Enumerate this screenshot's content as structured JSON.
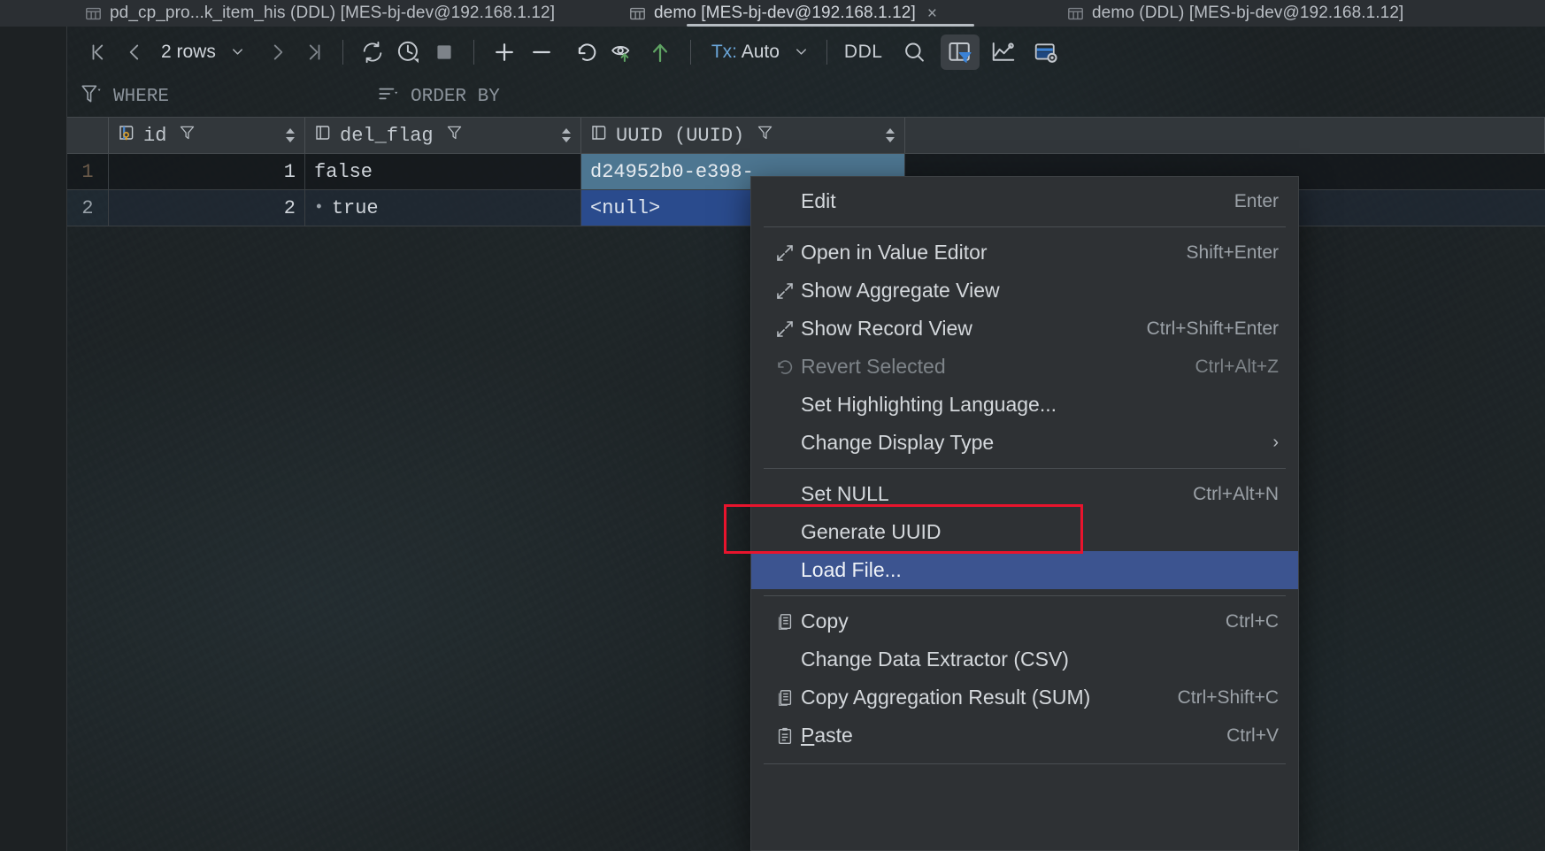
{
  "window": {
    "tabs": [
      {
        "label": "pd_cp_pro...k_item_his (DDL) [MES-bj-dev@192.168.1.12]",
        "icon": "table-icon",
        "active": false,
        "closable": false
      },
      {
        "label": "demo [MES-bj-dev@192.168.1.12]",
        "icon": "table-icon",
        "active": true,
        "closable": true,
        "close_label": "×"
      },
      {
        "label": "demo (DDL) [MES-bj-dev@192.168.1.12]",
        "icon": "table-icon",
        "active": false,
        "closable": false
      }
    ]
  },
  "toolbar": {
    "first_page": "first-page-icon",
    "prev_page": "prev-page-icon",
    "rows_label": "2 rows",
    "rows_chevron": "⌄",
    "next_page": "next-page-icon",
    "last_page": "last-page-icon",
    "reload": "reload-icon",
    "history": "history-icon",
    "stop": "stop-icon",
    "add_row": "plus-icon",
    "delete_row": "minus-icon",
    "revert": "revert-icon",
    "preview": "preview-changes-icon",
    "submit": "submit-icon",
    "tx_prefix": "Tx:",
    "tx_value": "Auto",
    "tx_chevron": "⌄",
    "ddl": "DDL",
    "search": "search-icon",
    "filter_panel": "toggle-filter-panel-icon",
    "chart": "chart-icon",
    "value_editor": "value-editor-icon"
  },
  "filterbar": {
    "where_icon": "filter-dropdown-icon",
    "where_label": "WHERE",
    "order_icon": "sort-dropdown-icon",
    "order_label": "ORDER BY"
  },
  "grid": {
    "columns": [
      {
        "key": "rownum",
        "label": "",
        "icon": "",
        "filter_icon": "",
        "sortable": false
      },
      {
        "key": "id",
        "label": "id",
        "icon": "primary-key-column-icon",
        "filter_icon": "column-filter-icon",
        "sortable": true
      },
      {
        "key": "del_flag",
        "label": "del_flag",
        "icon": "column-icon",
        "filter_icon": "column-filter-icon",
        "sortable": true
      },
      {
        "key": "uuid",
        "label": "UUID (UUID)",
        "icon": "column-icon",
        "filter_icon": "column-filter-icon",
        "sortable": true
      }
    ],
    "rows": [
      {
        "rownum": "1",
        "id": "1",
        "del_flag": "false",
        "del_flag_modified": false,
        "uuid": "d24952b0-e398-",
        "uuid_selected": true
      },
      {
        "rownum": "2",
        "id": "2",
        "del_flag": "true",
        "del_flag_modified": true,
        "uuid": "<null>",
        "uuid_selected": true
      }
    ],
    "modified_marker": "•"
  },
  "context_menu": {
    "items": [
      {
        "label": "Edit",
        "shortcut": "Enter",
        "icon": "",
        "state": "normal"
      },
      {
        "type": "separator"
      },
      {
        "label": "Open in Value Editor",
        "shortcut": "Shift+Enter",
        "icon": "expand-icon",
        "state": "normal"
      },
      {
        "label": "Show Aggregate View",
        "shortcut": "",
        "icon": "expand-icon",
        "state": "normal"
      },
      {
        "label": "Show Record View",
        "shortcut": "Ctrl+Shift+Enter",
        "icon": "expand-icon",
        "state": "normal"
      },
      {
        "label": "Revert Selected",
        "shortcut": "Ctrl+Alt+Z",
        "icon": "revert-icon",
        "state": "disabled"
      },
      {
        "label": "Set Highlighting Language...",
        "shortcut": "",
        "icon": "",
        "state": "normal"
      },
      {
        "label": "Change Display Type",
        "shortcut": "",
        "icon": "",
        "state": "normal",
        "submenu": "›"
      },
      {
        "type": "separator"
      },
      {
        "label": "Set NULL",
        "shortcut": "Ctrl+Alt+N",
        "icon": "",
        "state": "normal"
      },
      {
        "label": "Generate UUID",
        "shortcut": "",
        "icon": "",
        "state": "normal",
        "annotated": true
      },
      {
        "label": "Load File...",
        "shortcut": "",
        "icon": "",
        "state": "highlighted"
      },
      {
        "type": "separator"
      },
      {
        "label": "Copy",
        "shortcut": "Ctrl+C",
        "icon": "copy-icon",
        "state": "normal"
      },
      {
        "label": "Change Data Extractor (CSV)",
        "shortcut": "",
        "icon": "",
        "state": "normal"
      },
      {
        "label": "Copy Aggregation Result (SUM)",
        "shortcut": "Ctrl+Shift+C",
        "icon": "copy-icon",
        "state": "normal"
      },
      {
        "label": "Paste",
        "shortcut": "Ctrl+V",
        "icon": "paste-icon",
        "state": "normal",
        "mnemonic": "P"
      }
    ]
  },
  "annotation": {
    "color": "#e8142d",
    "target": "Generate UUID"
  }
}
